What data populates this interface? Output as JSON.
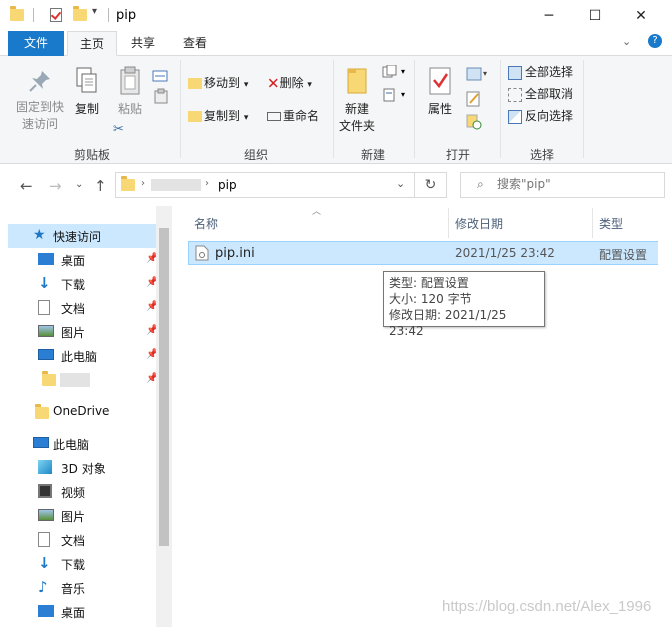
{
  "window": {
    "title": "pip",
    "controls": {
      "minimize": "─",
      "maximize": "☐",
      "close": "✕"
    }
  },
  "ribbon_tabs": {
    "file": "文件",
    "home": "主页",
    "share": "共享",
    "view": "查看"
  },
  "ribbon": {
    "clipboard": {
      "pin_label_line1": "固定到快",
      "pin_label_line2": "速访问",
      "copy": "复制",
      "paste": "粘贴",
      "group": "剪贴板"
    },
    "organize": {
      "move_to": "移动到",
      "copy_to": "复制到",
      "delete": "删除",
      "rename": "重命名",
      "group": "组织"
    },
    "new": {
      "new_folder_line1": "新建",
      "new_folder_line2": "文件夹",
      "group": "新建"
    },
    "open": {
      "properties": "属性",
      "group": "打开"
    },
    "select": {
      "select_all": "全部选择",
      "select_none": "全部取消",
      "invert": "反向选择",
      "group": "选择"
    }
  },
  "address": {
    "current_folder": "pip",
    "search_placeholder": "搜索\"pip\""
  },
  "nav": {
    "quick_access": "快速访问",
    "qa_items": [
      "桌面",
      "下载",
      "文档",
      "图片",
      "此电脑"
    ],
    "onedrive": "OneDrive",
    "this_pc": "此电脑",
    "pc_items": [
      "3D 对象",
      "视频",
      "图片",
      "文档",
      "下载",
      "音乐",
      "桌面"
    ]
  },
  "columns": {
    "name": "名称",
    "modified": "修改日期",
    "type": "类型"
  },
  "files": [
    {
      "name": "pip.ini",
      "modified": "2021/1/25 23:42",
      "type": "配置设置"
    }
  ],
  "tooltip": {
    "type": "类型: 配置设置",
    "size": "大小: 120 字节",
    "modified": "修改日期: 2021/1/25 23:42"
  },
  "watermark": "https://blog.csdn.net/Alex_1996",
  "colors": {
    "accent": "#1979ca",
    "selection": "#cce8ff",
    "selection_border": "#99d1ff",
    "folder": "#f8d775"
  }
}
